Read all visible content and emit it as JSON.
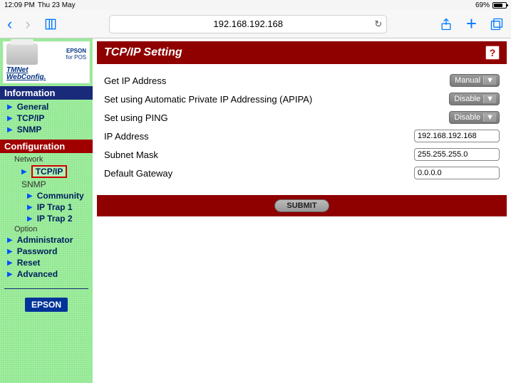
{
  "status": {
    "time": "12:09 PM",
    "date": "Thu 23 May",
    "battery": "69%"
  },
  "browser": {
    "url": "192.168.192.168"
  },
  "logo": {
    "brand": "EPSON",
    "sub": "for POS",
    "product1": "TMNet",
    "product2": "WebConfig."
  },
  "nav": {
    "info_header": "Information",
    "config_header": "Configuration",
    "info_items": [
      "General",
      "TCP/IP",
      "SNMP"
    ],
    "config_group1_label": "Network",
    "config_group1_items": [
      "TCP/IP",
      "SNMP"
    ],
    "snmp_children": [
      "Community",
      "IP Trap 1",
      "IP Trap 2"
    ],
    "config_group2_label": "Option",
    "config_group2_items": [
      "Administrator",
      "Password",
      "Reset",
      "Advanced"
    ]
  },
  "badge": "EPSON",
  "page": {
    "title": "TCP/IP Setting",
    "rows": {
      "get_ip": {
        "label": "Get IP Address",
        "value": "Manual"
      },
      "apipa": {
        "label": "Set using Automatic Private IP Addressing (APIPA)",
        "value": "Disable"
      },
      "ping": {
        "label": "Set using PING",
        "value": "Disable"
      },
      "ip": {
        "label": "IP Address",
        "value": "192.168.192.168"
      },
      "mask": {
        "label": "Subnet Mask",
        "value": "255.255.255.0"
      },
      "gw": {
        "label": "Default Gateway",
        "value": "0.0.0.0"
      }
    },
    "submit": "SUBMIT"
  }
}
